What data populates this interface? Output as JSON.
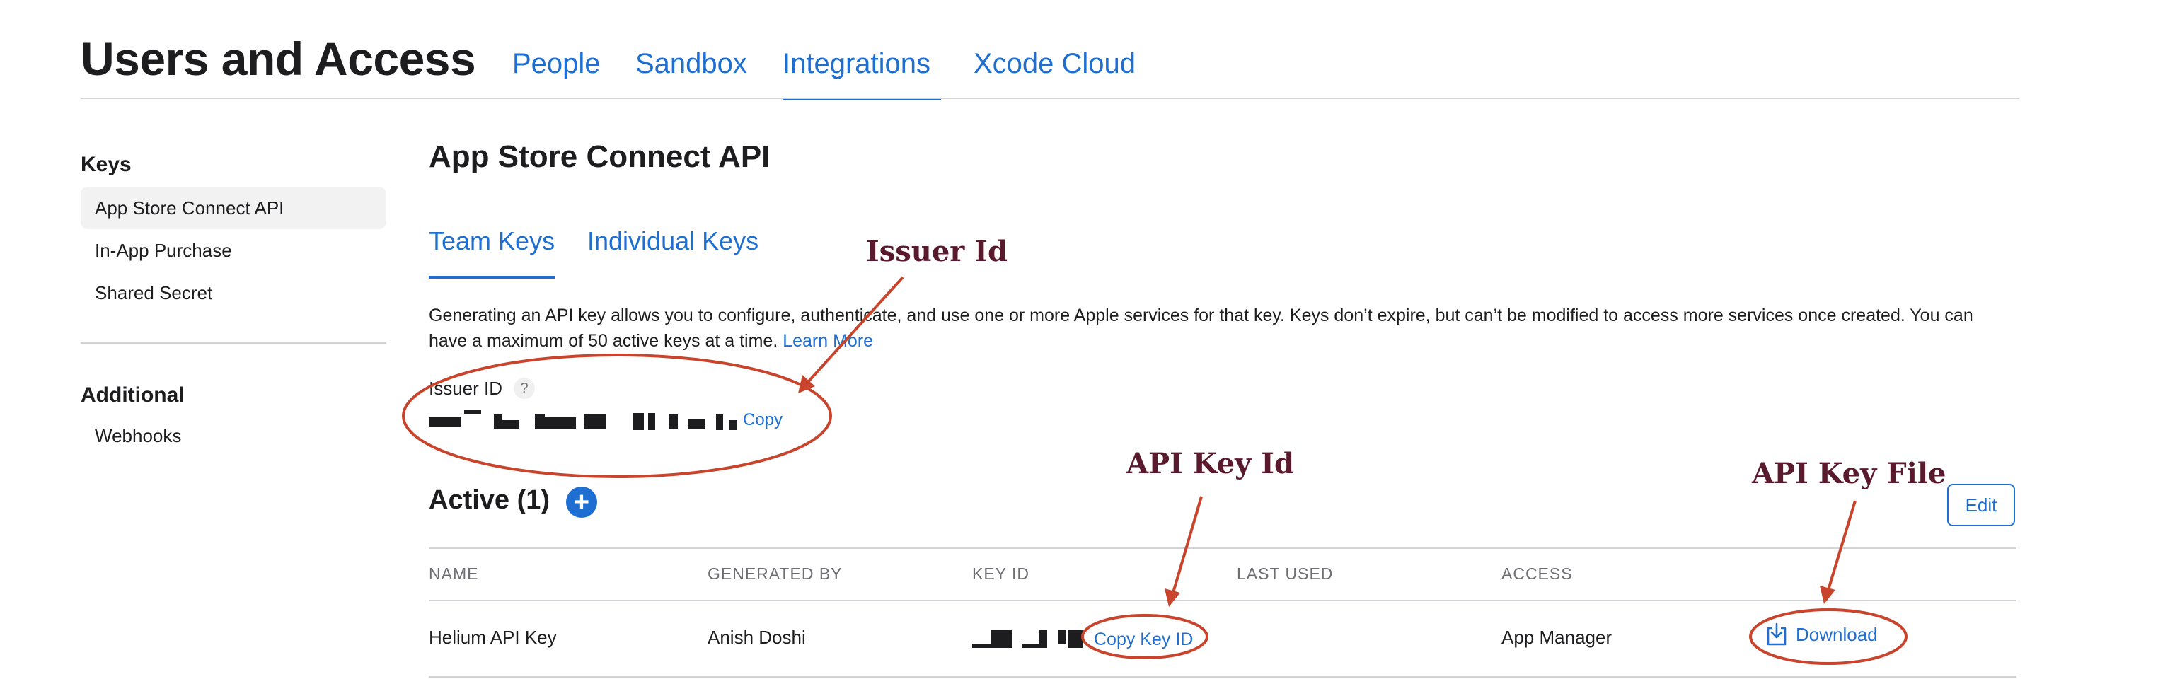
{
  "header": {
    "title": "Users and Access",
    "tabs": [
      "People",
      "Sandbox",
      "Integrations",
      "Xcode Cloud"
    ],
    "active_tab": "Integrations"
  },
  "sidebar": {
    "keys_heading": "Keys",
    "items": [
      "App Store Connect API",
      "In-App Purchase",
      "Shared Secret"
    ],
    "selected": "App Store Connect API",
    "additional_heading": "Additional",
    "additional_items": [
      "Webhooks"
    ]
  },
  "main": {
    "title": "App Store Connect API",
    "sub_tabs": [
      "Team Keys",
      "Individual Keys"
    ],
    "active_sub_tab": "Team Keys",
    "description": "Generating an API key allows you to configure, authenticate, and use one or more Apple services for that key. Keys don’t expire, but can’t be modified to access more services once created. You can have a maximum of 50 active keys at a time.",
    "learn_more": "Learn More",
    "issuer_label": "Issuer ID",
    "help_glyph": "?",
    "issuer_copy": "Copy",
    "active_title": "Active (1)",
    "add_glyph": "+",
    "edit_label": "Edit",
    "table": {
      "columns": [
        "NAME",
        "GENERATED BY",
        "KEY ID",
        "LAST USED",
        "ACCESS"
      ],
      "rows": [
        {
          "name": "Helium API Key",
          "generated_by": "Anish Doshi",
          "copy_key_id": "Copy Key ID",
          "last_used": "",
          "access": "App Manager",
          "download": "Download"
        }
      ]
    }
  },
  "annotations": {
    "issuer": "Issuer Id",
    "key_id": "API Key Id",
    "key_file": "API Key File",
    "color": "#c8442c",
    "label_color": "#5a1a2e"
  },
  "colors": {
    "accent": "#1e6fd1",
    "text": "#1d1d1f",
    "muted": "#6e6e73",
    "divider": "#d2d2d7"
  }
}
